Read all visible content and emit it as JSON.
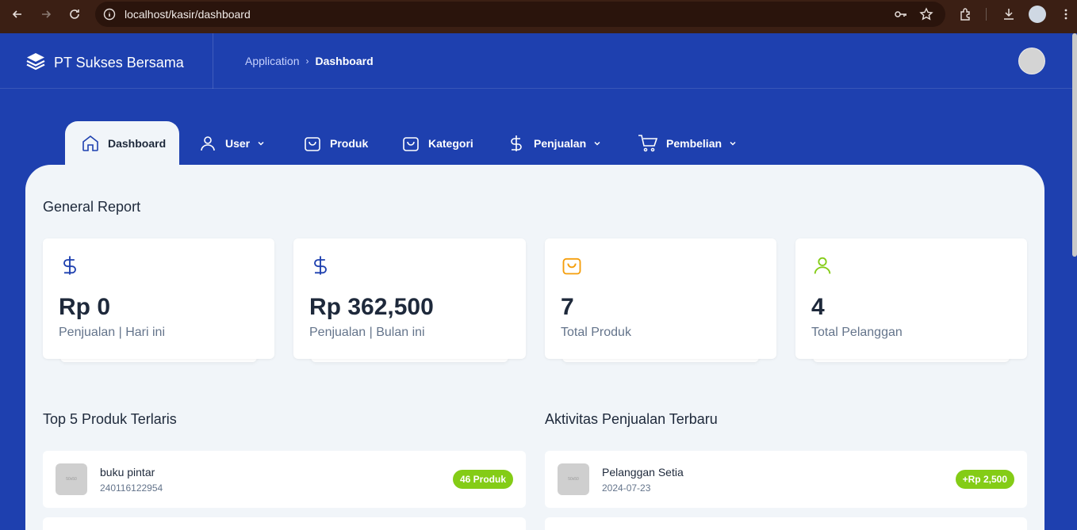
{
  "browser": {
    "url": "localhost/kasir/dashboard",
    "icons": [
      "back-icon",
      "forward-icon",
      "reload-icon",
      "site-info-icon",
      "key-icon",
      "star-icon",
      "extensions-icon",
      "download-icon",
      "profile-icon",
      "menu-icon"
    ]
  },
  "header": {
    "brand": "PT Sukses Bersama",
    "breadcrumb_parent": "Application",
    "breadcrumb_current": "Dashboard"
  },
  "nav": {
    "items": [
      {
        "label": "Dashboard",
        "icon": "home-icon",
        "active": true
      },
      {
        "label": "User",
        "icon": "user-icon",
        "dropdown": true
      },
      {
        "label": "Produk",
        "icon": "shopping-bag-icon"
      },
      {
        "label": "Kategori",
        "icon": "shopping-bag-icon"
      },
      {
        "label": "Penjualan",
        "icon": "dollar-icon",
        "dropdown": true
      },
      {
        "label": "Pembelian",
        "icon": "cart-icon",
        "dropdown": true
      }
    ]
  },
  "report": {
    "title": "General Report",
    "cards": [
      {
        "value": "Rp 0",
        "label": "Penjualan | Hari ini",
        "icon": "dollar-icon",
        "color": "#1e40af"
      },
      {
        "value": "Rp 362,500",
        "label": "Penjualan | Bulan ini",
        "icon": "dollar-icon",
        "color": "#1e40af"
      },
      {
        "value": "7",
        "label": "Total Produk",
        "icon": "shopping-bag-icon",
        "color": "#f59e0b"
      },
      {
        "value": "4",
        "label": "Total Pelanggan",
        "icon": "user-icon",
        "color": "#84cc16"
      }
    ]
  },
  "top_products": {
    "title": "Top 5 Produk Terlaris",
    "items": [
      {
        "name": "buku pintar",
        "code": "240116122954",
        "badge": "46 Produk"
      }
    ]
  },
  "recent_sales": {
    "title": "Aktivitas Penjualan Terbaru",
    "items": [
      {
        "name": "Pelanggan Setia",
        "date": "2024-07-23",
        "badge": "+Rp 2,500"
      }
    ]
  },
  "thumb_text": "50x50",
  "colors": {
    "primary": "#1e40af",
    "badge": "#84cc16",
    "panel": "#f1f5f9"
  }
}
